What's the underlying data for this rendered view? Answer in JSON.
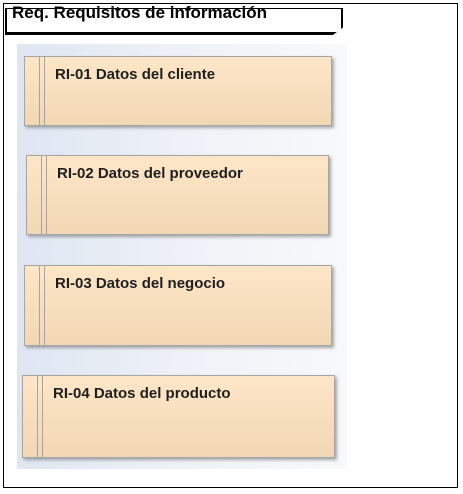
{
  "diagram": {
    "title": "Req. Requisitos de información",
    "requirements": [
      {
        "label": "RI-01 Datos del cliente"
      },
      {
        "label": "RI-02 Datos del proveedor"
      },
      {
        "label": "RI-03 Datos del negocio"
      },
      {
        "label": "RI-04 Datos del producto"
      }
    ]
  }
}
